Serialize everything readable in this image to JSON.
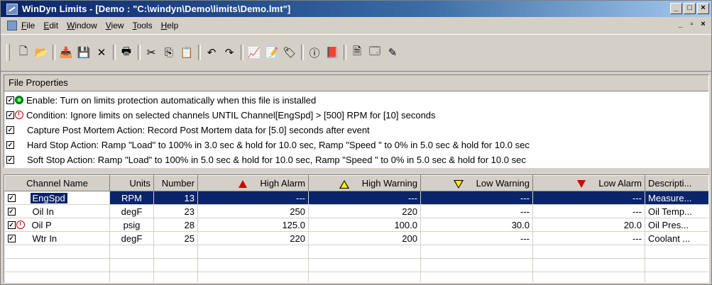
{
  "window": {
    "title": "WinDyn Limits - [Demo  :  \"C:\\windyn\\Demo\\limits\\Demo.lmt\"]",
    "controls": [
      "_",
      "□",
      "×"
    ]
  },
  "menu": {
    "items": [
      "File",
      "Edit",
      "Window",
      "View",
      "Tools",
      "Help"
    ],
    "mdi_controls": [
      "_",
      "▫",
      "×"
    ]
  },
  "toolbar": {
    "tools": [
      {
        "name": "new-file-icon",
        "glyph": "🗋"
      },
      {
        "name": "open-folder-icon",
        "glyph": "📂"
      },
      {
        "sep": true
      },
      {
        "name": "install-icon",
        "glyph": "📥"
      },
      {
        "name": "save-icon",
        "glyph": "💾"
      },
      {
        "name": "delete-icon",
        "glyph": "✕"
      },
      {
        "sep": true
      },
      {
        "name": "print-icon",
        "glyph": "🖶"
      },
      {
        "sep": true
      },
      {
        "name": "cut-icon",
        "glyph": "✂"
      },
      {
        "name": "copy-icon",
        "glyph": "⎘"
      },
      {
        "name": "paste-icon",
        "glyph": "📋"
      },
      {
        "sep": true
      },
      {
        "name": "undo-icon",
        "glyph": "↶"
      },
      {
        "name": "redo-icon",
        "glyph": "↷"
      },
      {
        "sep": true
      },
      {
        "name": "chart-icon",
        "glyph": "📈"
      },
      {
        "name": "edit-limits-icon",
        "glyph": "📝"
      },
      {
        "name": "tag-icon",
        "glyph": "🏷"
      },
      {
        "sep": true
      },
      {
        "name": "info-icon",
        "glyph": "ⓘ"
      },
      {
        "name": "book-icon",
        "glyph": "📕"
      },
      {
        "sep": true
      },
      {
        "name": "document-icon",
        "glyph": "🗎"
      },
      {
        "name": "properties-icon",
        "glyph": "🗔"
      },
      {
        "name": "pencil-icon",
        "glyph": "✎"
      }
    ]
  },
  "file_properties": {
    "header": "File Properties",
    "lines": [
      {
        "checked": true,
        "icon": "green",
        "text": "Enable: Turn on limits protection automatically when this file is installed"
      },
      {
        "checked": true,
        "icon": "clock",
        "text": "Condition: Ignore limits on selected channels UNTIL Channel[EngSpd] >  [500] RPM for [10] seconds"
      },
      {
        "checked": true,
        "icon": "none",
        "text": "Capture Post Mortem Action: Record Post Mortem data for [5.0] seconds after event"
      },
      {
        "checked": true,
        "icon": "none",
        "text": "Hard Stop Action: Ramp \"Load\" to 100% in 3.0 sec & hold for 10.0 sec,  Ramp \"Speed \" to 0% in 5.0 sec & hold for 10.0 sec"
      },
      {
        "checked": true,
        "icon": "none",
        "text": "Soft Stop Action: Ramp \"Load\" to 100% in 5.0 sec & hold for 10.0 sec,  Ramp \"Speed \" to 0% in 5.0 sec & hold for 10.0 sec"
      }
    ]
  },
  "grid": {
    "columns": [
      "Channel Name",
      "Units",
      "Number",
      "High Alarm",
      "High Warning",
      "Low Warning",
      "Low Alarm",
      "Descripti..."
    ],
    "rows": [
      {
        "checked": true,
        "icon": "none",
        "name": "EngSpd",
        "units": "RPM",
        "number": "13",
        "high_alarm": "---",
        "high_warning": "---",
        "low_warning": "---",
        "low_alarm": "---",
        "description": "Measure...",
        "selected": true
      },
      {
        "checked": true,
        "icon": "none",
        "name": "Oil In",
        "units": "degF",
        "number": "23",
        "high_alarm": "250",
        "high_warning": "220",
        "low_warning": "---",
        "low_alarm": "---",
        "description": "Oil Temp..."
      },
      {
        "checked": true,
        "icon": "clock",
        "name": "Oil P",
        "units": "psig",
        "number": "28",
        "high_alarm": "125.0",
        "high_warning": "100.0",
        "low_warning": "30.0",
        "low_alarm": "20.0",
        "description": "Oil Pres..."
      },
      {
        "checked": true,
        "icon": "none",
        "name": "Wtr In",
        "units": "degF",
        "number": "25",
        "high_alarm": "220",
        "high_warning": "200",
        "low_warning": "---",
        "low_alarm": "---",
        "description": "Coolant ..."
      }
    ],
    "empty_rows": 3
  }
}
